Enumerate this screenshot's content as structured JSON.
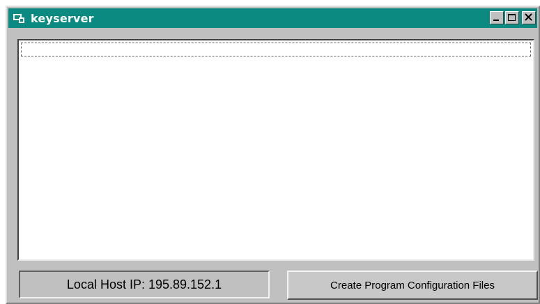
{
  "window": {
    "title": "keyserver",
    "title_bar_color": "#0a8a80",
    "controls": {
      "minimize_icon": "minimize-icon",
      "maximize_icon": "maximize-icon",
      "close_icon": "close-icon"
    }
  },
  "list": {
    "items": []
  },
  "status": {
    "ip_label": "Local Host IP: 195.89.152.1"
  },
  "actions": {
    "create_config_label": "Create Program Configuration Files"
  }
}
